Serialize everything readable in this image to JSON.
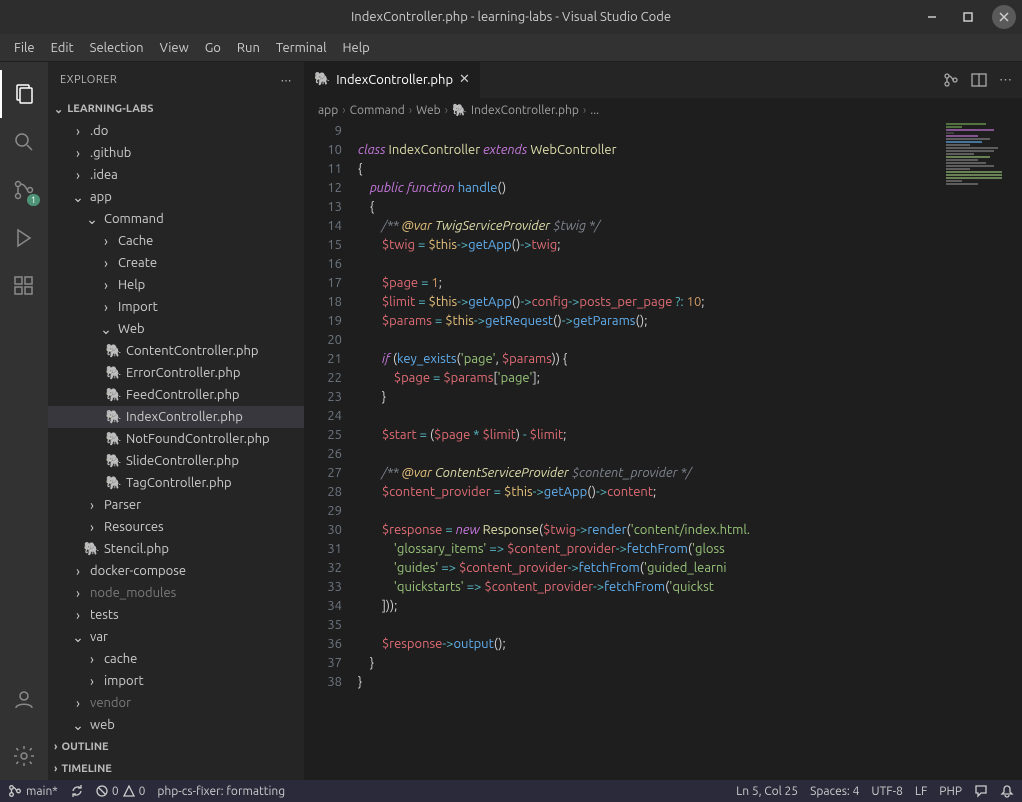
{
  "title": "IndexController.php - learning-labs - Visual Studio Code",
  "menu": [
    "File",
    "Edit",
    "Selection",
    "View",
    "Go",
    "Run",
    "Terminal",
    "Help"
  ],
  "explorer": {
    "title": "EXPLORER",
    "project": "LEARNING-LABS",
    "outline": "OUTLINE",
    "timeline": "TIMELINE"
  },
  "tree": {
    "do": ".do",
    "github": ".github",
    "idea": ".idea",
    "app": "app",
    "command": "Command",
    "cache": "Cache",
    "create": "Create",
    "help": "Help",
    "import": "Import",
    "web": "Web",
    "files": {
      "content": "ContentController.php",
      "error": "ErrorController.php",
      "feed": "FeedController.php",
      "index": "IndexController.php",
      "notfound": "NotFoundController.php",
      "slide": "SlideController.php",
      "tag": "TagController.php"
    },
    "parser": "Parser",
    "resources": "Resources",
    "stencil": "Stencil.php",
    "docker": "docker-compose",
    "node": "node_modules",
    "tests": "tests",
    "var": "var",
    "cache2": "cache",
    "import2": "import",
    "vendor": "vendor",
    "web2": "web"
  },
  "tab": {
    "name": "IndexController.php"
  },
  "breadcrumbs": {
    "b1": "app",
    "b2": "Command",
    "b3": "Web",
    "b4": "IndexController.php",
    "b5": "..."
  },
  "scm_badge": "1",
  "status": {
    "branch": "main*",
    "errors": "0",
    "warnings": "0",
    "formatter": "php-cs-fixer: formatting",
    "lncol": "Ln 5, Col 25",
    "spaces": "Spaces: 4",
    "encoding": "UTF-8",
    "eol": "LF",
    "lang": "PHP"
  },
  "lines": [
    9,
    10,
    11,
    12,
    13,
    14,
    15,
    16,
    17,
    18,
    19,
    20,
    21,
    22,
    23,
    24,
    25,
    26,
    27,
    28,
    29,
    30,
    31,
    32,
    33,
    34,
    35,
    36,
    37,
    38
  ]
}
